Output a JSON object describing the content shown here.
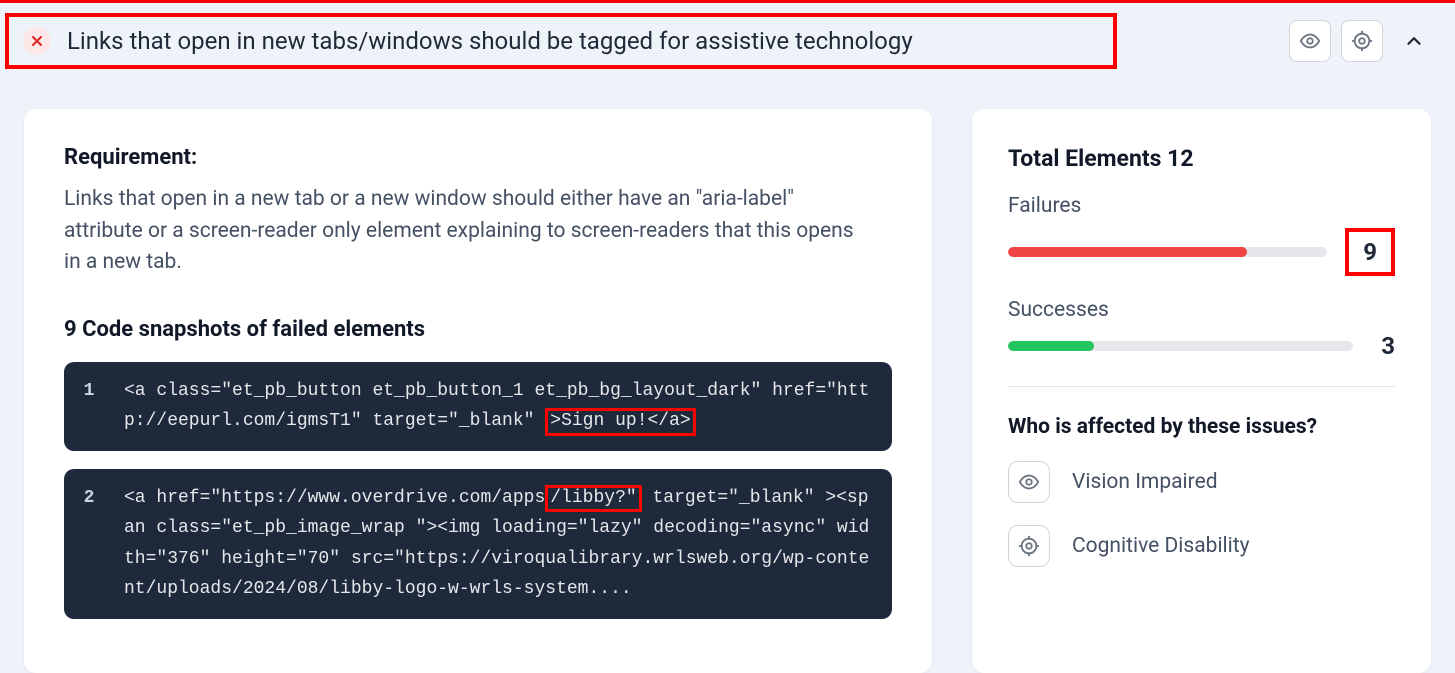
{
  "header": {
    "title": "Links that open in new tabs/windows should be tagged for assistive technology"
  },
  "main": {
    "requirement_label": "Requirement:",
    "requirement_text": "Links that open in a new tab or a new window should either have an \"aria-label\" attribute or a screen-reader only element explaining to screen-readers that this opens in a new tab.",
    "snapshot_title": "9 Code snapshots of failed elements",
    "snapshots": [
      {
        "num": "1",
        "pre": "<a class=\"et_pb_button et_pb_button_1 et_pb_bg_layout_dark\" href=\"http://eepurl.com/igmsT1\" target=\"_blank\" ",
        "hl": ">Sign up!</a>",
        "post": ""
      },
      {
        "num": "2",
        "pre": "<a href=\"https://www.overdrive.com/apps",
        "hl": "/libby?\"",
        "post": " target=\"_blank\" ><span class=\"et_pb_image_wrap \"><img loading=\"lazy\" decoding=\"async\" width=\"376\" height=\"70\" src=\"https://viroqualibrary.wrlsweb.org/wp-content/uploads/2024/08/libby-logo-w-wrls-system...."
      }
    ]
  },
  "side": {
    "total_label": "Total Elements 12",
    "failures_label": "Failures",
    "failures_num": "9",
    "successes_label": "Successes",
    "successes_num": "3",
    "who_title": "Who is affected by these issues?",
    "who": [
      {
        "label": "Vision Impaired",
        "icon": "eye"
      },
      {
        "label": "Cognitive Disability",
        "icon": "target"
      }
    ]
  }
}
